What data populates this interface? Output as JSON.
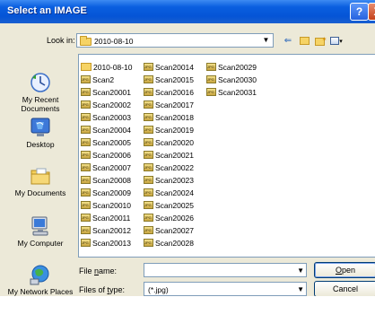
{
  "window": {
    "title": "Select an IMAGE"
  },
  "title_buttons": {
    "help": "?",
    "close": "X"
  },
  "lookin": {
    "label": "Look in:",
    "value": "2010-08-10"
  },
  "places": [
    {
      "label": "My Recent Documents"
    },
    {
      "label": "Desktop"
    },
    {
      "label": "My Documents"
    },
    {
      "label": "My Computer"
    },
    {
      "label": "My Network Places"
    }
  ],
  "files": {
    "col1": [
      {
        "name": "2010-08-10",
        "type": "folder"
      },
      {
        "name": "Scan2",
        "type": "jpg"
      },
      {
        "name": "Scan20001",
        "type": "jpg"
      },
      {
        "name": "Scan20002",
        "type": "jpg"
      },
      {
        "name": "Scan20003",
        "type": "jpg"
      },
      {
        "name": "Scan20004",
        "type": "jpg"
      },
      {
        "name": "Scan20005",
        "type": "jpg"
      },
      {
        "name": "Scan20006",
        "type": "jpg"
      },
      {
        "name": "Scan20007",
        "type": "jpg"
      },
      {
        "name": "Scan20008",
        "type": "jpg"
      },
      {
        "name": "Scan20009",
        "type": "jpg"
      },
      {
        "name": "Scan20010",
        "type": "jpg"
      },
      {
        "name": "Scan20011",
        "type": "jpg"
      },
      {
        "name": "Scan20012",
        "type": "jpg"
      },
      {
        "name": "Scan20013",
        "type": "jpg"
      }
    ],
    "col2": [
      {
        "name": "Scan20014",
        "type": "jpg"
      },
      {
        "name": "Scan20015",
        "type": "jpg"
      },
      {
        "name": "Scan20016",
        "type": "jpg"
      },
      {
        "name": "Scan20017",
        "type": "jpg"
      },
      {
        "name": "Scan20018",
        "type": "jpg"
      },
      {
        "name": "Scan20019",
        "type": "jpg"
      },
      {
        "name": "Scan20020",
        "type": "jpg"
      },
      {
        "name": "Scan20021",
        "type": "jpg"
      },
      {
        "name": "Scan20022",
        "type": "jpg"
      },
      {
        "name": "Scan20023",
        "type": "jpg"
      },
      {
        "name": "Scan20024",
        "type": "jpg"
      },
      {
        "name": "Scan20025",
        "type": "jpg"
      },
      {
        "name": "Scan20026",
        "type": "jpg"
      },
      {
        "name": "Scan20027",
        "type": "jpg"
      },
      {
        "name": "Scan20028",
        "type": "jpg"
      }
    ],
    "col3": [
      {
        "name": "Scan20029",
        "type": "jpg"
      },
      {
        "name": "Scan20030",
        "type": "jpg"
      },
      {
        "name": "Scan20031",
        "type": "jpg"
      }
    ]
  },
  "filename": {
    "label_pre": "File ",
    "label_u": "n",
    "label_post": "ame:",
    "value": ""
  },
  "filetype": {
    "label_pre": "Files of ",
    "label_u": "t",
    "label_post": "ype:",
    "value": "(*.jpg)"
  },
  "buttons": {
    "open_u": "O",
    "open_rest": "pen",
    "cancel": "Cancel"
  },
  "colors": {
    "titlebar": "#0554d6",
    "dialog_bg": "#ece9d8",
    "border": "#7f9db9"
  }
}
